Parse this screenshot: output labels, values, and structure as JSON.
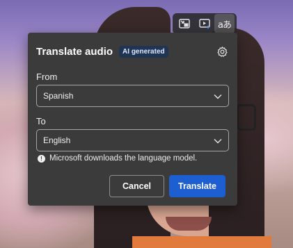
{
  "toolbar": {
    "buttons": [
      {
        "icon": "picture-in-picture-icon"
      },
      {
        "icon": "video-sparkle-icon"
      },
      {
        "icon": "translate-icon",
        "glyph": "aあ",
        "active": true
      }
    ]
  },
  "dialog": {
    "title": "Translate audio",
    "badge": "AI generated",
    "settings_icon": "gear-icon",
    "from_label": "From",
    "from_value": "Spanish",
    "to_label": "To",
    "to_value": "English",
    "info_text": "Microsoft downloads the language model.",
    "info_glyph": "!",
    "cancel_label": "Cancel",
    "translate_label": "Translate"
  },
  "colors": {
    "dialog_bg": "#3b3b3b",
    "badge_bg": "#1f3553",
    "primary_button": "#1d5fd1"
  }
}
